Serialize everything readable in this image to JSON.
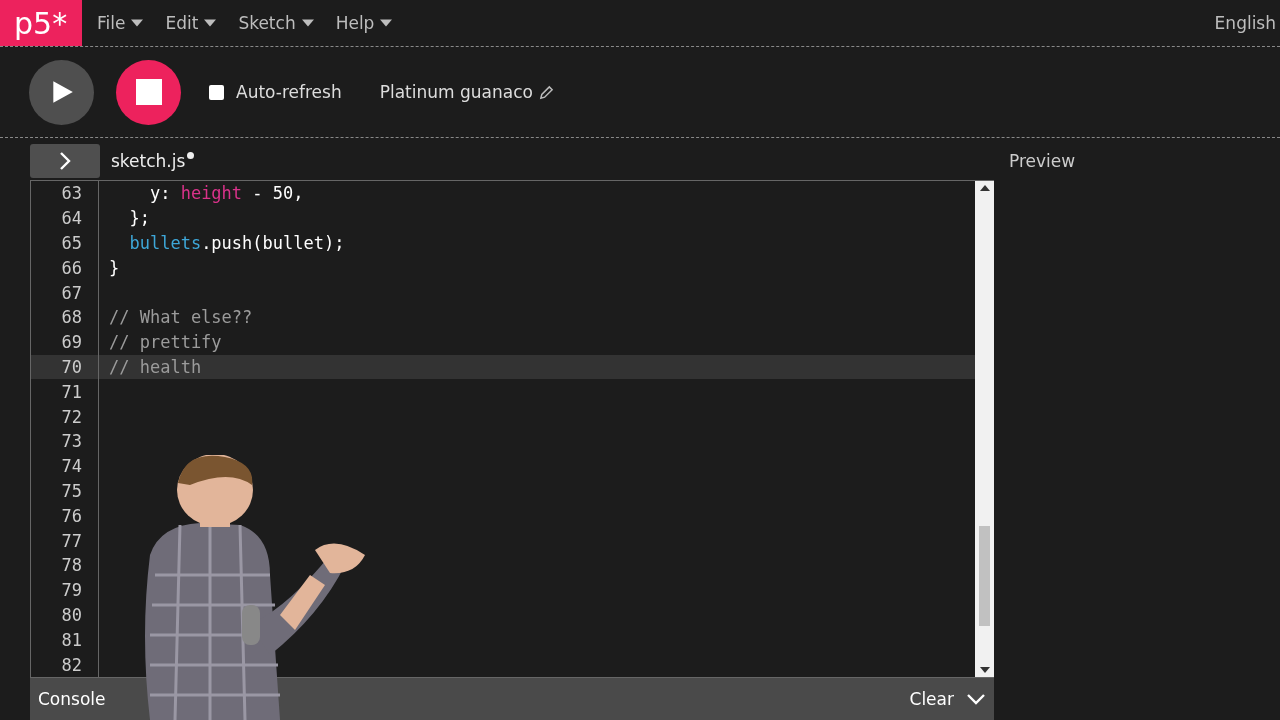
{
  "logo": "p5*",
  "menu": [
    {
      "label": "File"
    },
    {
      "label": "Edit"
    },
    {
      "label": "Sketch"
    },
    {
      "label": "Help"
    }
  ],
  "language": "English",
  "toolbar": {
    "auto_refresh": {
      "label": "Auto-refresh",
      "checked": false
    },
    "sketch_name": "Platinum guanaco"
  },
  "file_tab": {
    "name": "sketch.js",
    "unsaved": true
  },
  "preview_label": "Preview",
  "code_lines": [
    {
      "number": "63",
      "active": false,
      "tokens": [
        {
          "text": "    y: ",
          "kind": "plain"
        },
        {
          "text": "height",
          "kind": "keyword"
        },
        {
          "text": " - 50,",
          "kind": "plain"
        }
      ]
    },
    {
      "number": "64",
      "active": false,
      "tokens": [
        {
          "text": "  };",
          "kind": "plain"
        }
      ]
    },
    {
      "number": "65",
      "active": false,
      "tokens": [
        {
          "text": "  bullets",
          "kind": "variable"
        },
        {
          "text": ".push(bullet);",
          "kind": "plain"
        }
      ]
    },
    {
      "number": "66",
      "active": false,
      "tokens": [
        {
          "text": "}",
          "kind": "plain"
        }
      ]
    },
    {
      "number": "67",
      "active": false
    },
    {
      "number": "68",
      "active": false,
      "tokens": [
        {
          "text": "// What else??",
          "kind": "comment"
        }
      ]
    },
    {
      "number": "69",
      "active": false,
      "tokens": [
        {
          "text": "// prettify",
          "kind": "comment"
        }
      ]
    },
    {
      "number": "70",
      "active": true,
      "tokens": [
        {
          "text": "// health",
          "kind": "comment"
        }
      ]
    },
    {
      "number": "71",
      "active": false
    },
    {
      "number": "72",
      "active": false
    },
    {
      "number": "73",
      "active": false
    },
    {
      "number": "74",
      "active": false
    },
    {
      "number": "75",
      "active": false
    },
    {
      "number": "76",
      "active": false
    },
    {
      "number": "77",
      "active": false
    },
    {
      "number": "78",
      "active": false
    },
    {
      "number": "79",
      "active": false
    },
    {
      "number": "80",
      "active": false
    },
    {
      "number": "81",
      "active": false
    },
    {
      "number": "82",
      "active": false
    }
  ],
  "console": {
    "title": "Console",
    "clear": "Clear"
  }
}
